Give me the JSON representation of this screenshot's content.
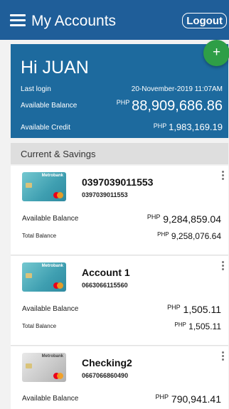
{
  "header": {
    "title": "My Accounts",
    "logout_label": "Logout"
  },
  "summary": {
    "greeting": "Hi JUAN",
    "last_login_label": "Last login",
    "last_login_value": "20-November-2019 11:07AM",
    "available_balance_label": "Available Balance",
    "available_balance_currency": "PHP",
    "available_balance_value": "88,909,686.86",
    "available_credit_label": "Available Credit",
    "available_credit_currency": "PHP",
    "available_credit_value": "1,983,169.19"
  },
  "section": {
    "title": "Current & Savings"
  },
  "accounts": [
    {
      "name": "0397039011553",
      "number": "0397039011553",
      "card_brand": "Metrobank",
      "card_style": "teal",
      "available_label": "Available Balance",
      "available_currency": "PHP",
      "available_value": "9,284,859.04",
      "total_label": "Total Balance",
      "total_currency": "PHP",
      "total_value": "9,258,076.64"
    },
    {
      "name": "Account 1",
      "number": "0663066115560",
      "card_brand": "Metrobank",
      "card_style": "teal",
      "available_label": "Available Balance",
      "available_currency": "PHP",
      "available_value": "1,505.11",
      "total_label": "Total Balance",
      "total_currency": "PHP",
      "total_value": "1,505.11"
    },
    {
      "name": "Checking2",
      "number": "0667066860490",
      "card_brand": "Metrobank",
      "card_style": "silver",
      "available_label": "Available Balance",
      "available_currency": "PHP",
      "available_value": "790,941.41"
    }
  ],
  "colors": {
    "app_bar": "#1f5e99",
    "hero": "#1d6a9e",
    "fab": "#2e9e47",
    "section_header": "#dedede"
  },
  "icons": {
    "menu": "hamburger-icon",
    "add": "plus-icon",
    "more": "more-vertical-icon"
  }
}
